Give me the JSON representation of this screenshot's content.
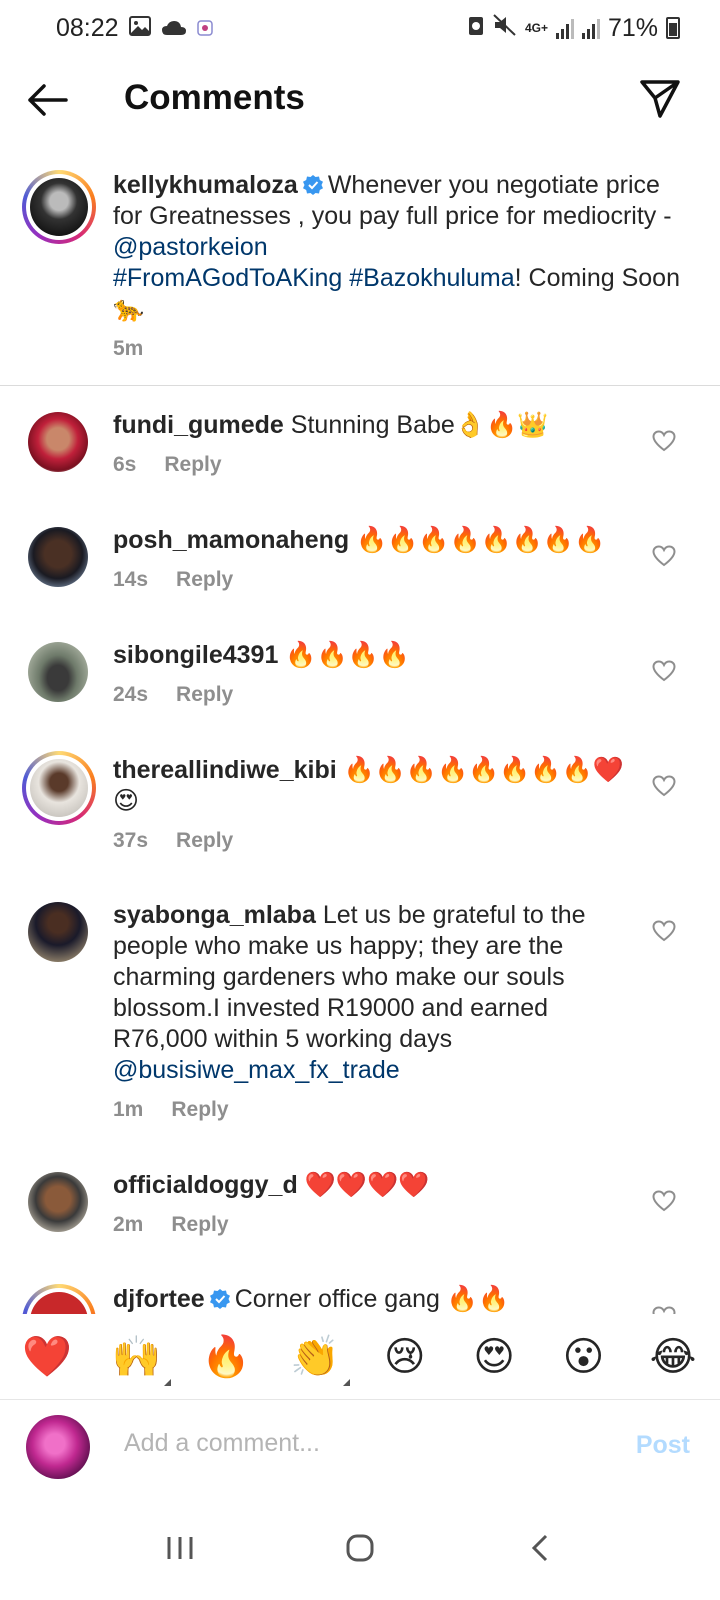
{
  "status": {
    "time": "08:22",
    "battery": "71%",
    "network": "4G+"
  },
  "header": {
    "title": "Comments"
  },
  "caption": {
    "username": "kellykhumaloza",
    "text_part1": "Whenever you negotiate price for Greatnesses , you pay full price for mediocrity - ",
    "mention": "@pastorkeion",
    "hashtag1": "#FromAGodToAKing",
    "hashtag2": "#Bazokhuluma",
    "text_part2": "! Coming Soon 🐆",
    "time": "5m"
  },
  "comments": [
    {
      "username": "fundi_gumede",
      "text": "Stunning Babe👌🔥👑",
      "time": "6s",
      "reply": "Reply"
    },
    {
      "username": "posh_mamonaheng",
      "text": "🔥🔥🔥🔥🔥🔥🔥🔥",
      "time": "14s",
      "reply": "Reply"
    },
    {
      "username": "sibongile4391",
      "text": "🔥🔥🔥🔥",
      "time": "24s",
      "reply": "Reply"
    },
    {
      "username": "thereallindiwe_kibi",
      "text": "🔥🔥🔥🔥🔥🔥🔥🔥❤️😍",
      "time": "37s",
      "reply": "Reply"
    },
    {
      "username": "syabonga_mlaba",
      "text": "Let us be grateful to the people who make us happy; they are the charming gardeners who make our souls blossom.I invested R19000 and earned R76,000 within 5 working days ",
      "mention": "@busisiwe_max_fx_trade",
      "time": "1m",
      "reply": "Reply"
    },
    {
      "username": "officialdoggy_d",
      "text": "❤️❤️❤️❤️",
      "time": "2m",
      "reply": "Reply"
    },
    {
      "username": "djfortee",
      "text": "Corner office gang 🔥🔥"
    }
  ],
  "emoji_bar": [
    "❤️",
    "🙌",
    "🔥",
    "👏",
    "😢",
    "😍",
    "😮",
    "😂"
  ],
  "composer": {
    "placeholder": "Add a comment...",
    "post_label": "Post"
  },
  "colors": {
    "link": "#00376b",
    "verified": "#3897f0",
    "post_disabled": "#b3dbff",
    "meta": "#8e8e8e"
  }
}
